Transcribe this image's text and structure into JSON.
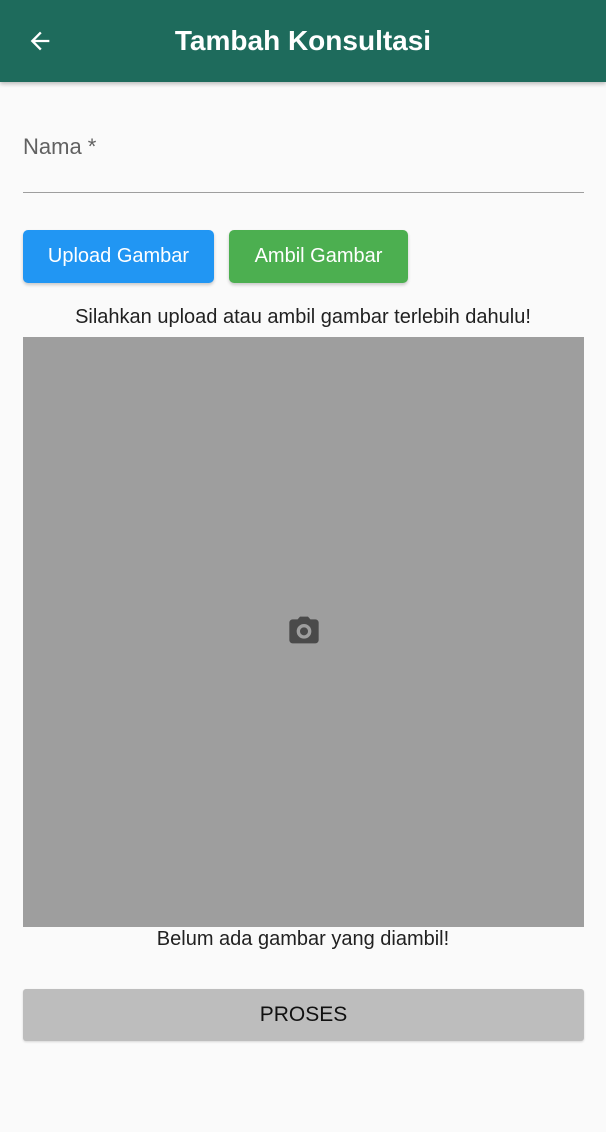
{
  "appbar": {
    "title": "Tambah Konsultasi",
    "back_icon": "arrow-left-icon",
    "background_color": "#1e6b5c"
  },
  "form": {
    "name_label": "Nama *",
    "name_value": ""
  },
  "buttons": {
    "upload_label": "Upload Gambar",
    "upload_color": "#2196f3",
    "ambil_label": "Ambil Gambar",
    "ambil_color": "#4caf50"
  },
  "image_section": {
    "instruction": "Silahkan upload atau ambil gambar terlebih dahulu!",
    "placeholder_icon": "camera-icon",
    "empty_message": "Belum ada gambar yang diambil!"
  },
  "submit": {
    "label": "PROSES"
  }
}
